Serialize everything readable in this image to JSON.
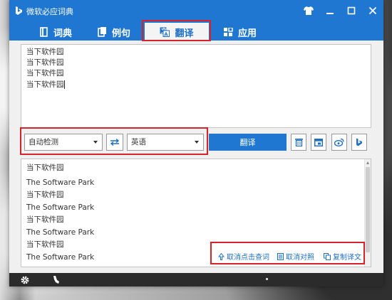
{
  "window": {
    "title": "微软必应词典",
    "accent_color": "#1f77d1",
    "controls": [
      {
        "icon": "tshirt-skin-icon"
      },
      {
        "icon": "minimize-icon"
      },
      {
        "icon": "maximize-icon"
      },
      {
        "icon": "close-icon"
      }
    ]
  },
  "tabs": [
    {
      "label": "词典",
      "icon": "book-icon",
      "active": false
    },
    {
      "label": "例句",
      "icon": "document-icon",
      "active": false
    },
    {
      "label": "翻译",
      "icon": "translate-icon",
      "active": true
    },
    {
      "label": "应用",
      "icon": "grid-icon",
      "active": false
    }
  ],
  "source": {
    "lines": [
      "当下软件园",
      "当下软件园",
      "当下软件园",
      "当下软件园"
    ]
  },
  "toolbar": {
    "from_language": "自动检测",
    "to_language": "英语",
    "translate_label": "翻译",
    "tools": [
      {
        "icon": "trash-icon"
      },
      {
        "icon": "window-icon"
      },
      {
        "icon": "weibo-icon"
      },
      {
        "icon": "bing-icon"
      }
    ]
  },
  "result": {
    "items": [
      {
        "zh": "当下软件园",
        "en": "The Software Park"
      },
      {
        "zh": "当下软件园",
        "en": "The Software Park"
      },
      {
        "zh": "当下软件园",
        "en": "The Software Park"
      },
      {
        "zh": "当下软件园",
        "en": "The Software Park"
      }
    ],
    "actions": [
      {
        "label": "取消点击查词",
        "icon": "pointer-icon"
      },
      {
        "label": "取消对照",
        "icon": "list-icon"
      },
      {
        "label": "复制译文",
        "icon": "copy-icon"
      }
    ]
  },
  "highlight_color": "#d6232b"
}
